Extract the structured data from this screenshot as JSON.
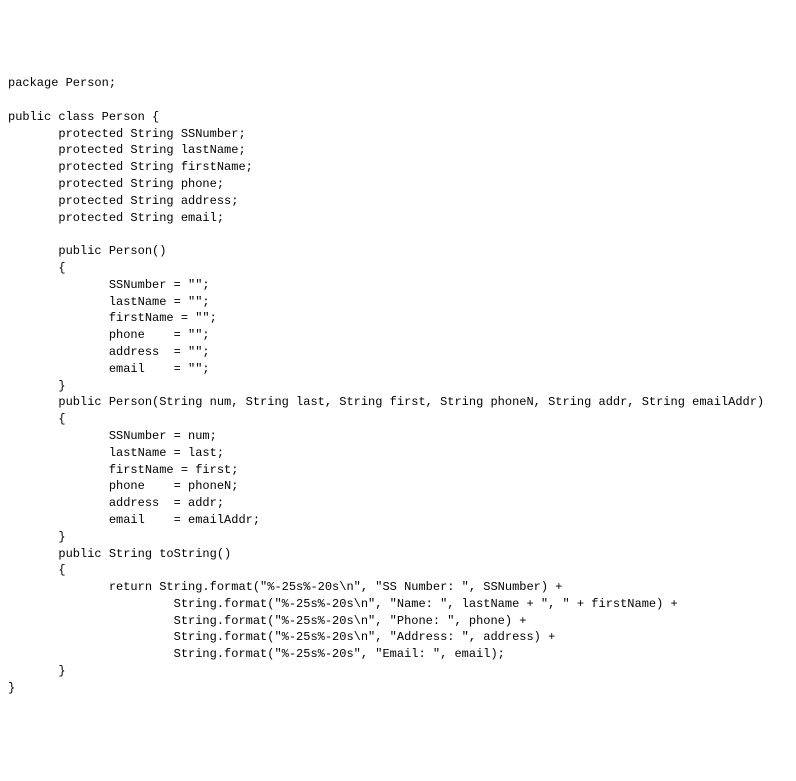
{
  "code": {
    "lines": [
      "package Person;",
      "",
      "public class Person {",
      "       protected String SSNumber;",
      "       protected String lastName;",
      "       protected String firstName;",
      "       protected String phone;",
      "       protected String address;",
      "       protected String email;",
      "",
      "       public Person()",
      "       {",
      "              SSNumber = \"\";",
      "              lastName = \"\";",
      "              firstName = \"\";",
      "              phone    = \"\";",
      "              address  = \"\";",
      "              email    = \"\";",
      "       }",
      "       public Person(String num, String last, String first, String phoneN, String addr, String emailAddr)",
      "       {",
      "              SSNumber = num;",
      "              lastName = last;",
      "              firstName = first;",
      "              phone    = phoneN;",
      "              address  = addr;",
      "              email    = emailAddr;",
      "       }",
      "       public String toString()",
      "       {",
      "              return String.format(\"%-25s%-20s\\n\", \"SS Number: \", SSNumber) +",
      "                       String.format(\"%-25s%-20s\\n\", \"Name: \", lastName + \", \" + firstName) +",
      "                       String.format(\"%-25s%-20s\\n\", \"Phone: \", phone) +",
      "                       String.format(\"%-25s%-20s\\n\", \"Address: \", address) +",
      "                       String.format(\"%-25s%-20s\", \"Email: \", email);",
      "       }",
      "}"
    ]
  }
}
